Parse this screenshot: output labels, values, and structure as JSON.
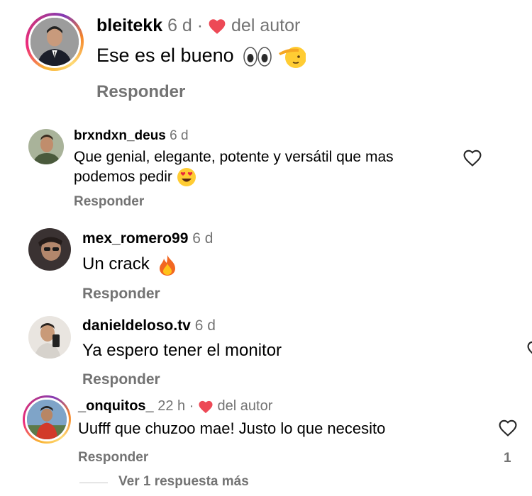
{
  "comments": [
    {
      "username": "bleitekk",
      "time": "6 d",
      "separator": "·",
      "author_like": "del autor",
      "text": "Ese es el bueno",
      "emojis": [
        "eyes",
        "saluting-face"
      ],
      "reply": "Responder"
    },
    {
      "username": "brxndxn_deus",
      "time": "6 d",
      "text": "Que genial, elegante, potente y versátil que mas podemos pedir",
      "emojis": [
        "heart-eyes-face"
      ],
      "reply": "Responder"
    },
    {
      "username": "mex_romero99",
      "time": "6 d",
      "text": "Un crack",
      "emojis": [
        "fire"
      ],
      "reply": "Responder"
    },
    {
      "username": "danieldeloso.tv",
      "time": "6 d",
      "text": "Ya espero tener el monitor",
      "reply": "Responder"
    },
    {
      "username": "_onquitos_",
      "time": "22 h",
      "separator": "·",
      "author_like": "del autor",
      "text": "Uufff que chuzoo mae! Justo lo que necesito",
      "reply": "Responder",
      "like_count": "1",
      "more_replies": "Ver 1 respuesta más"
    }
  ],
  "colors": {
    "heart_red": "#ed4956",
    "meta_gray": "#737373",
    "line_gray": "#c7c7c7"
  }
}
